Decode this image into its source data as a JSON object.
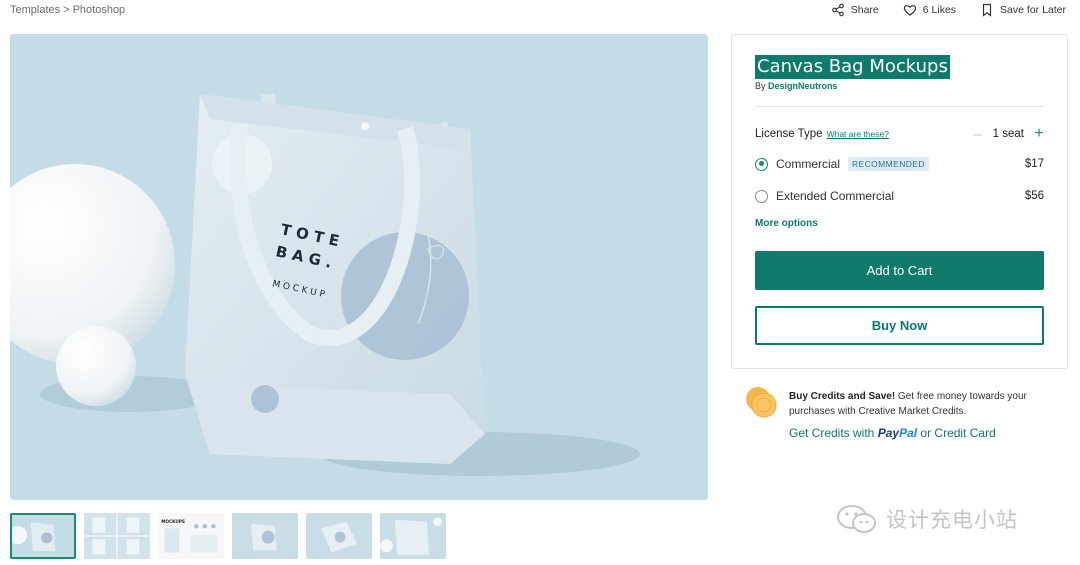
{
  "breadcrumb": {
    "items": [
      "Templates",
      "Photoshop"
    ],
    "separator": ">"
  },
  "topbar": {
    "share": "Share",
    "likes": "6 Likes",
    "save": "Save for Later"
  },
  "hero": {
    "mockup_lines": [
      "T O T E",
      "B A G .",
      "M O C K U P"
    ]
  },
  "thumbnails": {
    "count": 6,
    "active_index": 0,
    "label_3": "MOCKUPS"
  },
  "product": {
    "title": "Canvas Bag Mockups",
    "by_prefix": "By",
    "author": "DesignNeutrons"
  },
  "license": {
    "label": "License Type",
    "help_link": "What are these?",
    "seat_value": "1 seat",
    "options": [
      {
        "label": "Commercial",
        "badge": "RECOMMENDED",
        "price": "$17",
        "selected": true
      },
      {
        "label": "Extended Commercial",
        "badge": "",
        "price": "$56",
        "selected": false
      }
    ],
    "more_options": "More options"
  },
  "actions": {
    "add_to_cart": "Add to Cart",
    "buy_now": "Buy Now"
  },
  "credits": {
    "bold": "Buy Credits and Save!",
    "text": " Get free money towards your purchases with Creative Market Credits.",
    "link_prefix": "Get Credits with",
    "paypal_pay": "Pay",
    "paypal_pal": "Pal",
    "link_suffix": "or Credit Card"
  },
  "watermark": {
    "text": "设计充电小站"
  },
  "colors": {
    "accent": "#0e7a6b",
    "badge_bg": "#dcecf7",
    "hero_bg": "#c4dce6"
  }
}
